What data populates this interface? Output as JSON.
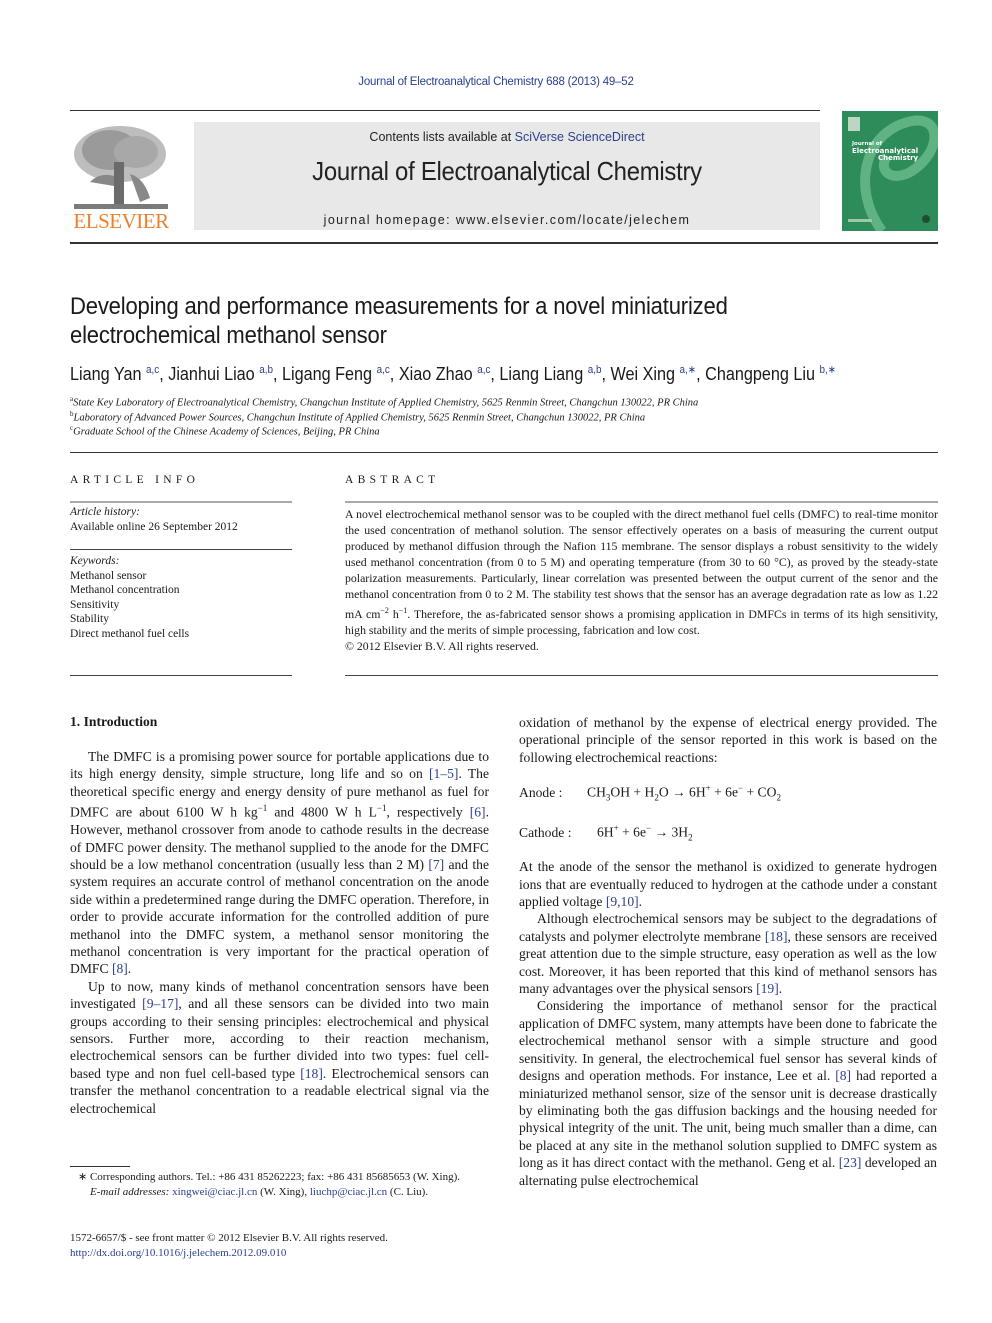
{
  "header": {
    "running_head": "Journal of Electroanalytical Chemistry 688 (2013) 49–52",
    "contents_prefix": "Contents lists available at ",
    "contents_link": "SciVerse ScienceDirect",
    "journal_title": "Journal of Electroanalytical Chemistry",
    "homepage": "journal homepage: www.elsevier.com/locate/jelechem",
    "publisher_logo_text": "ELSEVIER",
    "cover_title_line1": "Journal of",
    "cover_title_line2": "Electroanalytical",
    "cover_title_line3": "Chemistry",
    "colors": {
      "publisher_orange": "#ee7f2d",
      "link_blue": "#2a3f8f",
      "cover_green": "#2e8b5a",
      "banner_gray": "#e8e8e8"
    }
  },
  "article": {
    "title_line1": "Developing and performance measurements for a novel miniaturized",
    "title_line2": "electrochemical methanol sensor",
    "authors": [
      {
        "name": "Liang Yan",
        "aff": "a,c",
        "sep": ", "
      },
      {
        "name": "Jianhui Liao",
        "aff": "a,b",
        "sep": ", "
      },
      {
        "name": "Ligang Feng",
        "aff": "a,c",
        "sep": ", "
      },
      {
        "name": "Xiao Zhao",
        "aff": "a,c",
        "sep": ", "
      },
      {
        "name": "Liang Liang",
        "aff": "a,b",
        "sep": ", "
      },
      {
        "name": "Wei Xing",
        "aff": "a,∗",
        "sep": ", "
      },
      {
        "name": "Changpeng Liu",
        "aff": "b,∗",
        "sep": ""
      }
    ],
    "affiliations": [
      {
        "mark": "a",
        "text": "State Key Laboratory of Electroanalytical Chemistry, Changchun Institute of Applied Chemistry, 5625 Renmin Street, Changchun 130022, PR China"
      },
      {
        "mark": "b",
        "text": "Laboratory of Advanced Power Sources, Changchun Institute of Applied Chemistry, 5625 Renmin Street, Changchun 130022, PR China"
      },
      {
        "mark": "c",
        "text": "Graduate School of the Chinese Academy of Sciences, Beijing, PR China"
      }
    ]
  },
  "article_info": {
    "heading": "ARTICLE INFO",
    "history_label": "Article history:",
    "history_value": "Available online 26 September 2012",
    "keywords_label": "Keywords:",
    "keywords": [
      "Methanol sensor",
      "Methanol concentration",
      "Sensitivity",
      "Stability",
      "Direct methanol fuel cells"
    ]
  },
  "abstract": {
    "heading": "ABSTRACT",
    "text_part1": "A novel electrochemical methanol sensor was to be coupled with the direct methanol fuel cells (DMFC) to real-time monitor the used concentration of methanol solution. The sensor effectively operates on a basis of measuring the current output produced by methanol diffusion through the Nafion 115 membrane. The sensor displays a robust sensitivity to the widely used methanol concentration (from 0 to 5 M) and operating temperature (from 30 to 60 °C), as proved by the steady-state polarization measurements. Particularly, linear correlation was presented between the output current of the senor and the methanol concentration from 0 to 2 M. The stability test shows that the sensor has an average degradation rate as low as 1.22 mA cm",
    "exp1": "−2",
    "text_part2": " h",
    "exp2": "−1",
    "text_part3": ". Therefore, the as-fabricated sensor shows a promising application in DMFCs in terms of its high sensitivity, high stability and the merits of simple processing, fabrication and low cost.",
    "copyright": "© 2012 Elsevier B.V. All rights reserved."
  },
  "body": {
    "section_heading": "1. Introduction",
    "left": {
      "p1_a": "The DMFC is a promising power source for portable applications due to its high energy density, simple structure, long life and so on ",
      "p1_ref1": "[1–5]",
      "p1_b": ". The theoretical specific energy and energy density of pure methanol as fuel for DMFC are about 6100 W h kg",
      "p1_exp1": "−1",
      "p1_c": " and 4800 W h L",
      "p1_exp2": "−1",
      "p1_d": ", respectively ",
      "p1_ref2": "[6]",
      "p1_e": ". However, methanol crossover from anode to cathode results in the decrease of DMFC power density. The methanol supplied to the anode for the DMFC should be a low methanol concentration (usually less than 2 M) ",
      "p1_ref3": "[7]",
      "p1_f": " and the system requires an accurate control of methanol concentration on the anode side within a predetermined range during the DMFC operation. Therefore, in order to provide accurate information for the controlled addition of pure methanol into the DMFC system, a methanol sensor monitoring the methanol concentration is very important for the practical operation of DMFC ",
      "p1_ref4": "[8]",
      "p1_g": ".",
      "p2_a": "Up to now, many kinds of methanol concentration sensors have been investigated ",
      "p2_ref1": "[9–17]",
      "p2_b": ", and all these sensors can be divided into two main groups according to their sensing principles: electrochemical and physical sensors. Further more, according to their reaction mechanism, electrochemical sensors can be further divided into two types: fuel cell-based type and non fuel cell-based type ",
      "p2_ref2": "[18]",
      "p2_c": ". Electrochemical sensors can transfer the methanol concentration to a readable electrical signal via the electrochemical"
    },
    "right": {
      "p0": "oxidation of methanol by the expense of electrical energy provided. The operational principle of the sensor reported in this work is based on the following electrochemical reactions:",
      "anode_label": "Anode :",
      "cathode_label": "Cathode :",
      "p3_a": "At the anode of the sensor the methanol is oxidized to generate hydrogen ions that are eventually reduced to hydrogen at the cathode under a constant applied voltage ",
      "p3_ref": "[9,10]",
      "p3_b": ".",
      "p4_a": "Although electrochemical sensors may be subject to the degradations of catalysts and polymer electrolyte membrane ",
      "p4_ref1": "[18]",
      "p4_b": ", these sensors are received great attention due to the simple structure, easy operation as well as the low cost. Moreover, it has been reported that this kind of methanol sensors has many advantages over the physical sensors ",
      "p4_ref2": "[19]",
      "p4_c": ".",
      "p5_a": "Considering the importance of methanol sensor for the practical application of DMFC system, many attempts have been done to fabricate the electrochemical methanol sensor with a simple structure and good sensitivity. In general, the electrochemical fuel sensor has several kinds of designs and operation methods. For instance, Lee et al. ",
      "p5_ref1": "[8]",
      "p5_b": " had reported a miniaturized methanol sensor, size of the sensor unit is decrease drastically by eliminating both the gas diffusion backings and the housing needed for physical integrity of the unit. The unit, being much smaller than a dime, can be placed at any site in the methanol solution supplied to DMFC system as long as it has direct contact with the methanol. Geng et al. ",
      "p5_ref2": "[23]",
      "p5_c": " developed an alternating pulse electrochemical"
    }
  },
  "footnotes": {
    "corresponding": "∗ Corresponding authors. Tel.: +86 431 85262223; fax: +86 431 85685653 (W. Xing).",
    "email_label": "E-mail addresses:",
    "email1": "xingwei@ciac.jl.cn",
    "email1_owner": " (W. Xing), ",
    "email2": "liuchp@ciac.jl.cn",
    "email2_owner": " (C. Liu).",
    "issn": "1572-6657/$ - see front matter © 2012 Elsevier B.V. All rights reserved.",
    "doi": "http://dx.doi.org/10.1016/j.jelechem.2012.09.010"
  }
}
